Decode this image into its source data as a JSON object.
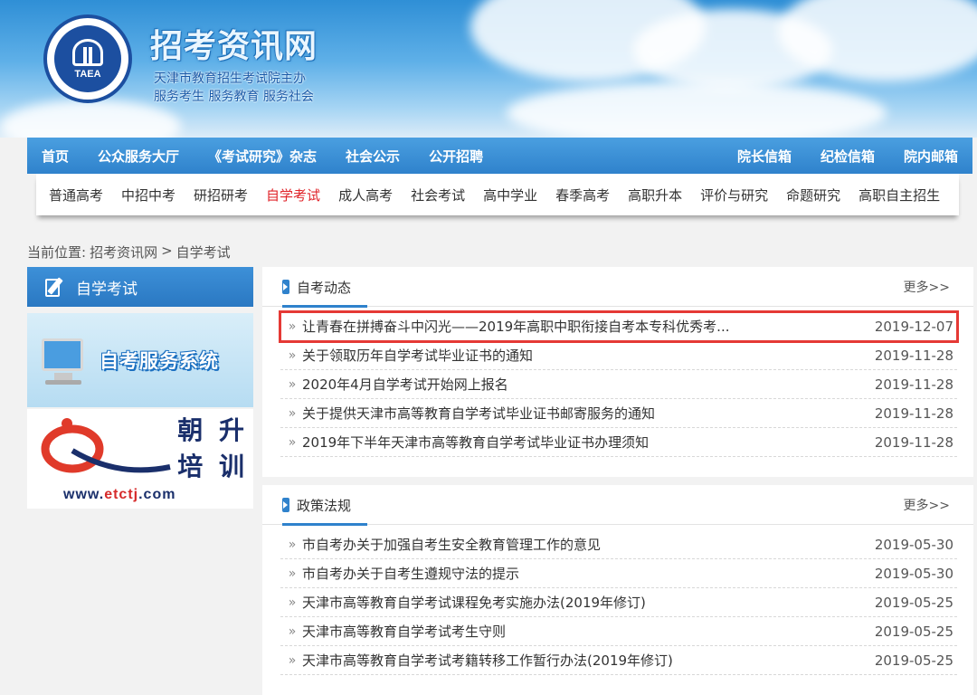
{
  "header": {
    "logo_text": "TAEA",
    "site_title": "招考资讯网",
    "subtitle1": "天津市教育招生考试院主办",
    "subtitle2": "服务考生 服务教育 服务社会"
  },
  "main_nav": {
    "left": [
      "首页",
      "公众服务大厅",
      "《考试研究》杂志",
      "社会公示",
      "公开招聘"
    ],
    "right": [
      "院长信箱",
      "纪检信箱",
      "院内邮箱"
    ]
  },
  "sub_nav": {
    "items": [
      "普通高考",
      "中招中考",
      "研招研考",
      "自学考试",
      "成人高考",
      "社会考试",
      "高中学业",
      "春季高考",
      "高职升本",
      "评价与研究",
      "命题研究",
      "高职自主招生"
    ],
    "active": "自学考试"
  },
  "breadcrumb": {
    "label": "当前位置:",
    "home": "招考资讯网",
    "sep": ">",
    "current": "自学考试"
  },
  "sidebar": {
    "title": "自学考试",
    "promo1": "自考服务系统",
    "promo2_line1": "朝 升",
    "promo2_line2": "培 训",
    "promo2_url_prefix": "www.",
    "promo2_url_mid": "etctj",
    "promo2_url_suffix": ".com"
  },
  "panel1": {
    "title": "自考动态",
    "more": "更多>>",
    "items": [
      {
        "title": "让青春在拼搏奋斗中闪光——2019年高职中职衔接自考本专科优秀考...",
        "date": "2019-12-07"
      },
      {
        "title": "关于领取历年自学考试毕业证书的通知",
        "date": "2019-11-28"
      },
      {
        "title": "2020年4月自学考试开始网上报名",
        "date": "2019-11-28"
      },
      {
        "title": "关于提供天津市高等教育自学考试毕业证书邮寄服务的通知",
        "date": "2019-11-28"
      },
      {
        "title": "2019年下半年天津市高等教育自学考试毕业证书办理须知",
        "date": "2019-11-28"
      }
    ]
  },
  "panel2": {
    "title": "政策法规",
    "more": "更多>>",
    "items": [
      {
        "title": "市自考办关于加强自考生安全教育管理工作的意见",
        "date": "2019-05-30"
      },
      {
        "title": "市自考办关于自考生遵规守法的提示",
        "date": "2019-05-30"
      },
      {
        "title": "天津市高等教育自学考试课程免考实施办法(2019年修订)",
        "date": "2019-05-25"
      },
      {
        "title": "天津市高等教育自学考试考生守则",
        "date": "2019-05-25"
      },
      {
        "title": "天津市高等教育自学考试考籍转移工作暂行办法(2019年修订)",
        "date": "2019-05-25"
      }
    ]
  }
}
